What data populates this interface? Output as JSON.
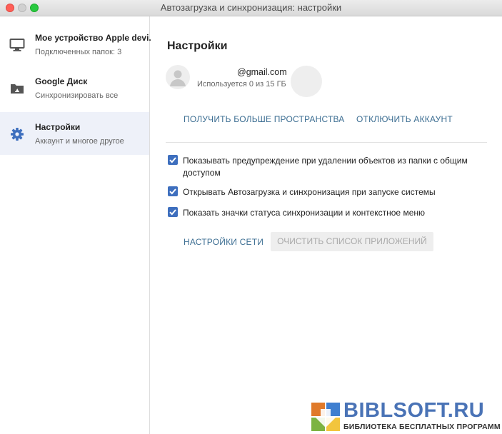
{
  "window": {
    "title": "Автозагрузка и синхронизация: настройки"
  },
  "sidebar": {
    "items": [
      {
        "title": "Мое устройство Apple devi.",
        "subtitle": "Подключенных папок: 3",
        "icon": "monitor-icon"
      },
      {
        "title": "Google Диск",
        "subtitle": "Синхронизировать все",
        "icon": "drive-folder-icon"
      },
      {
        "title": "Настройки",
        "subtitle": "Аккаунт и многое другое",
        "icon": "gear-icon",
        "active": true
      }
    ]
  },
  "main": {
    "heading": "Настройки",
    "account": {
      "email": "@gmail.com",
      "usage": "Используется 0 из 15 ГБ"
    },
    "actions": {
      "get_more_storage": "ПОЛУЧИТЬ БОЛЬШЕ ПРОСТРАНСТВА",
      "disconnect_account": "ОТКЛЮЧИТЬ АККАУНТ"
    },
    "options": [
      {
        "label_line1": "Показывать предупреждение при удалении объектов из папки с общим",
        "label_line2": "доступом",
        "checked": true
      },
      {
        "label_line1": "Открывать Автозагрузка и синхронизация при запуске системы",
        "checked": true
      },
      {
        "label_line1": "Показать значки статуса синхронизации и контекстное меню",
        "checked": true
      }
    ],
    "network_settings": "НАСТРОЙКИ СЕТИ",
    "clear_apps": "ОЧИСТИТЬ СПИСОК ПРИЛОЖЕНИЙ"
  },
  "watermark": {
    "brand": "BIBLSOFT.RU",
    "tagline": "БИБЛИОТЕКА БЕСПЛАТНЫХ ПРОГРАММ"
  },
  "colors": {
    "accent": "#3e6fbe",
    "link": "#3e6f93",
    "sidebar_active": "#eef1f9",
    "watermark_brand": "#4a73b6"
  }
}
